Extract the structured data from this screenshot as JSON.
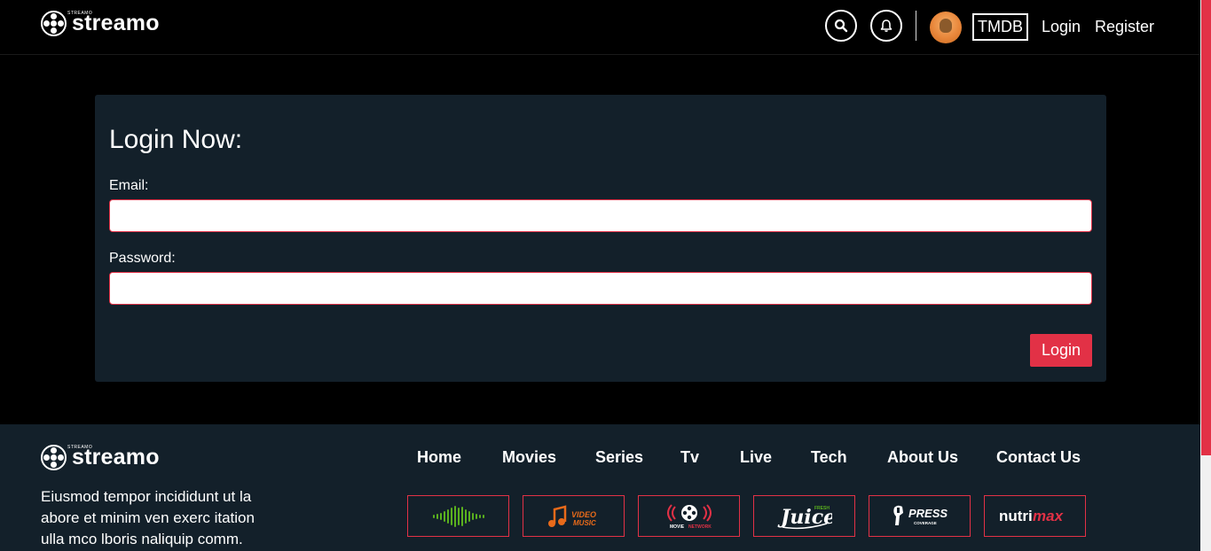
{
  "header": {
    "logo_text": "streamo",
    "logo_tag": "STREAMO",
    "tmdb_label": "TMDB",
    "login_label": "Login",
    "register_label": "Register"
  },
  "login_card": {
    "title": "Login Now:",
    "email_label": "Email:",
    "email_value": "",
    "password_label": "Password:",
    "password_value": "",
    "submit_label": "Login"
  },
  "footer": {
    "logo_text": "streamo",
    "description": "Eiusmod tempor incididunt ut la abore et minim ven exerc itation ulla mco lboris naliquip comm.",
    "nav": [
      "Home",
      "Movies",
      "Series",
      "Tv",
      "Live",
      "Tech",
      "About Us",
      "Contact Us"
    ],
    "partners": [
      {
        "name": "soundwave",
        "icon": "soundwave-logo"
      },
      {
        "name": "VIDEO MUSIC",
        "icon": "video-music-logo"
      },
      {
        "name": "MOVIE NETWORK",
        "icon": "movie-network-logo"
      },
      {
        "name": "Juice FRESH",
        "icon": "juice-logo"
      },
      {
        "name": "PRESS COVERAGE",
        "icon": "press-logo"
      },
      {
        "name": "nutrimax",
        "icon": "nutrimax-logo"
      }
    ]
  },
  "colors": {
    "accent": "#e23146",
    "card_bg": "#13202a",
    "page_bg": "#000000"
  }
}
